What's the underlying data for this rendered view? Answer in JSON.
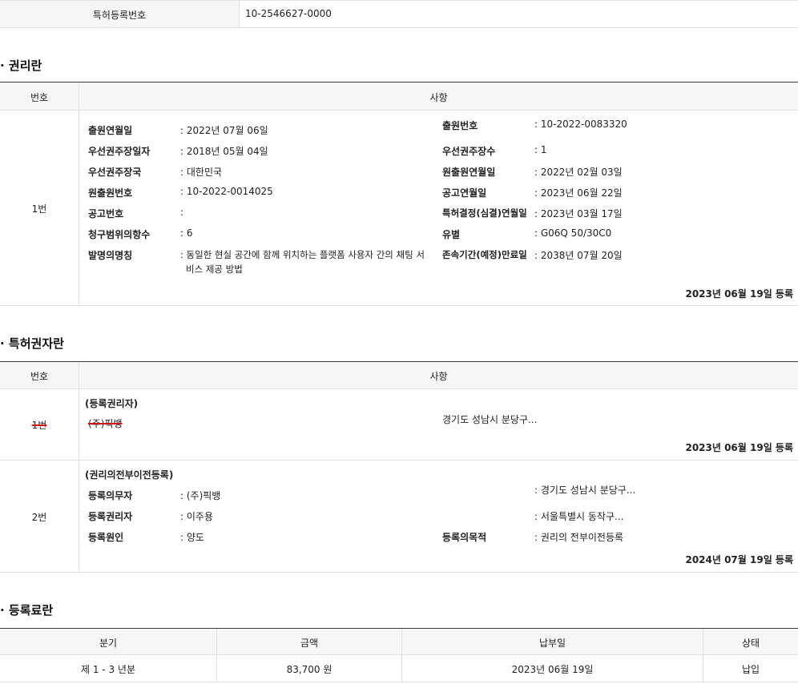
{
  "top": {
    "label": "특허등록번호",
    "value": "10-2546627-0000"
  },
  "rights": {
    "title": "· 권리란",
    "col_no": "번호",
    "col_item": "사항",
    "row_no": "1번",
    "left": [
      {
        "label": "출원연월일",
        "value": ": 2022년 07월 06일"
      },
      {
        "label": "우선권주장일자",
        "value": ": 2018년 05월 04일"
      },
      {
        "label": "우선권주장국",
        "value": ": 대한민국"
      },
      {
        "label": "원출원번호",
        "value": ": 10-2022-0014025"
      },
      {
        "label": "공고번호",
        "value": ":"
      },
      {
        "label": "청구범위의항수",
        "value": ": 6"
      },
      {
        "label": "발명의명칭",
        "value_line1": ": 동일한 현실 공간에 함께 위치하는 플랫폼 사용자 간의 채팅 서",
        "value_line2": "비스 제공 방법"
      }
    ],
    "right": [
      {
        "label": "출원번호",
        "value": ": 10-2022-0083320"
      },
      {
        "label": "우선권주장수",
        "value": ": 1"
      },
      {
        "label": "원출원연월일",
        "value": ": 2022년 02월 03일"
      },
      {
        "label": "공고연월일",
        "value": ": 2023년 06월 22일"
      },
      {
        "label": "특허결정(심결)연월일",
        "value": ": 2023년 03월 17일"
      },
      {
        "label": "유별",
        "value": ": G06Q 50/30C0"
      },
      {
        "label": "존속기간(예정)만료일",
        "value": ": 2038년 07월 20일"
      }
    ],
    "registered": "2023년 06월 19일 등록"
  },
  "owners": {
    "title": "· 특허권자란",
    "col_no": "번호",
    "col_item": "사항",
    "row1": {
      "no": "1번",
      "heading": "(등록권리자)",
      "name": "(주)픽뱅",
      "address": "경기도 성남시 분당구...",
      "registered": "2023년 06월 19일 등록"
    },
    "row2": {
      "no": "2번",
      "heading": "(권리의전부이전등록)",
      "obligor_label": "등록의무자",
      "obligor_value": ": (주)픽뱅",
      "obligor_address": ": 경기도 성남시 분당구...",
      "holder_label": "등록권리자",
      "holder_value": ": 이주용",
      "holder_address": ": 서울특별시 동작구...",
      "cause_label": "등록원인",
      "cause_value": ": 양도",
      "purpose_label": "등록의목적",
      "purpose_value": ": 권리의 전부이전등록",
      "registered": "2024년 07월 19일 등록"
    }
  },
  "fees": {
    "title": "· 등록료란",
    "headers": [
      "분기",
      "금액",
      "납부일",
      "상태"
    ],
    "row": [
      "제 1 - 3 년분",
      "83,700 원",
      "2023년 06월 19일",
      "납입"
    ]
  },
  "colors": {
    "header_bg": "#f6f6f6",
    "border": "#e2e2e2",
    "strike": "#cc1111"
  }
}
